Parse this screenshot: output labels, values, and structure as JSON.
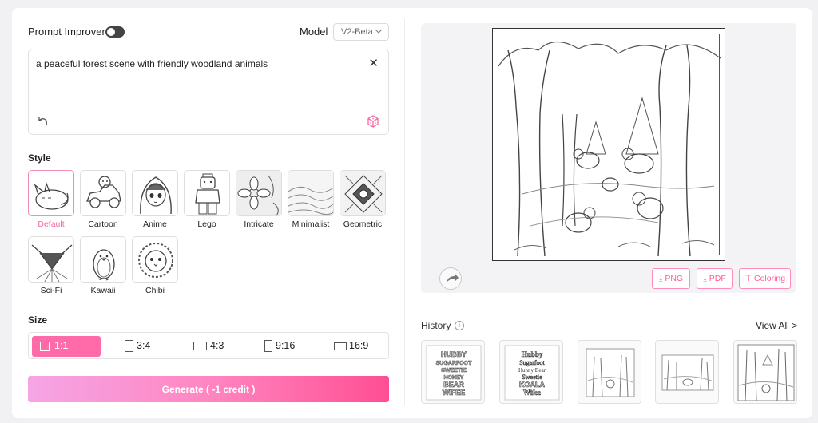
{
  "prompt_improver": {
    "label": "Prompt Improver",
    "enabled": false
  },
  "model": {
    "label": "Model",
    "selected": "V2-Beta"
  },
  "prompt": {
    "text": "a peaceful forest scene with friendly woodland animals",
    "close_glyph": "✕"
  },
  "style": {
    "title": "Style",
    "items": [
      {
        "label": "Default",
        "icon": "sleeping-fox",
        "selected": true
      },
      {
        "label": "Cartoon",
        "icon": "cartoon-car"
      },
      {
        "label": "Anime",
        "icon": "anime-girl"
      },
      {
        "label": "Lego",
        "icon": "lego-figure"
      },
      {
        "label": "Intricate",
        "icon": "intricate-flower"
      },
      {
        "label": "Minimalist",
        "icon": "minimalist-landscape"
      },
      {
        "label": "Geometric",
        "icon": "geometric-pattern"
      },
      {
        "label": "Sci-Fi",
        "icon": "sci-fi-ship"
      },
      {
        "label": "Kawaii",
        "icon": "kawaii-penguin"
      },
      {
        "label": "Chibi",
        "icon": "chibi-lion"
      }
    ]
  },
  "size": {
    "title": "Size",
    "options": [
      {
        "label": "1:1",
        "selected": true
      },
      {
        "label": "3:4"
      },
      {
        "label": "4:3"
      },
      {
        "label": "9:16"
      },
      {
        "label": "16:9"
      }
    ]
  },
  "generate": {
    "label": "Generate ( -1 credit )"
  },
  "preview": {
    "actions": [
      {
        "label": "PNG",
        "icon": "download-icon"
      },
      {
        "label": "PDF",
        "icon": "download-icon"
      },
      {
        "label": "Coloring",
        "icon": "paint-roller-icon"
      }
    ]
  },
  "history": {
    "title": "History",
    "view_all": "View All >",
    "items": [
      {
        "lines": [
          "HUBBY",
          "SUGARFOOT",
          "SWEETIE",
          "HONEY",
          "BEAR",
          "WIFEE"
        ]
      },
      {
        "lines": [
          "Hubby",
          "Sugarfoot",
          "Hunny Bear",
          "Sweetie",
          "KOALA",
          "Wifee"
        ]
      },
      {
        "lines": []
      },
      {
        "lines": []
      },
      {
        "lines": []
      }
    ]
  },
  "colors": {
    "accent": "#ff5b9d",
    "accent_light": "#f58bb7",
    "gen_start": "#f5a5e6",
    "gen_end": "#ff4f93"
  }
}
